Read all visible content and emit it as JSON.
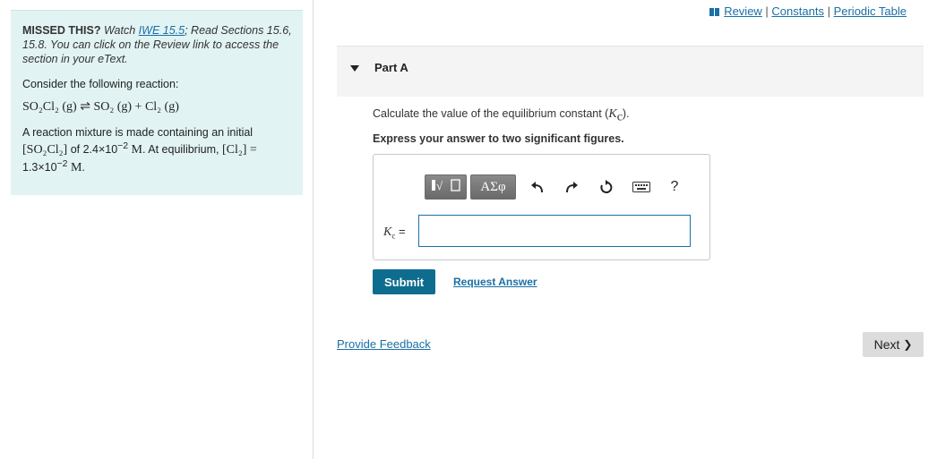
{
  "top_links": {
    "review": "Review",
    "sep1": " | ",
    "constants": "Constants",
    "sep2": " | ",
    "periodic_table": "Periodic Table"
  },
  "left_panel": {
    "missed_bold": "MISSED THIS?",
    "missed_text1": " Watch ",
    "iwe_link": "IWE 15.5",
    "missed_text2": "; Read Sections 15.6, 15.8. You can click on the Review link to access the section in your eText.",
    "consider": "Consider the following reaction:",
    "equation": "SO₂Cl₂ (g)  ⇌  SO₂ (g)  +  Cl₂ (g)",
    "mixture_1": "A reaction mixture is made containing an initial ",
    "mixture_conc1": "[SO₂Cl₂]",
    "mixture_2": " of 2.4×10",
    "mixture_exp1": "−2",
    "mixture_unit1": " M",
    "mixture_3": ". At equilibrium, ",
    "mixture_conc2": "[Cl₂] =",
    "mixture_4": "1.3×10",
    "mixture_exp2": "−2",
    "mixture_unit2": " M",
    "mixture_5": "."
  },
  "part": {
    "title": "Part A",
    "question": "Calculate the value of the equilibrium constant (",
    "question_sym": "K",
    "question_sub": "c",
    "question_end": ").",
    "instruction": "Express your answer to two significant figures."
  },
  "answer": {
    "label_sym": "K",
    "label_sub": "c",
    "label_eq": " =",
    "value": "",
    "toolbar": {
      "greek_label": "ΑΣφ",
      "help_label": "?"
    }
  },
  "actions": {
    "submit": "Submit",
    "request_answer": "Request Answer",
    "provide_feedback": "Provide Feedback",
    "next": "Next",
    "next_glyph": "❯"
  }
}
